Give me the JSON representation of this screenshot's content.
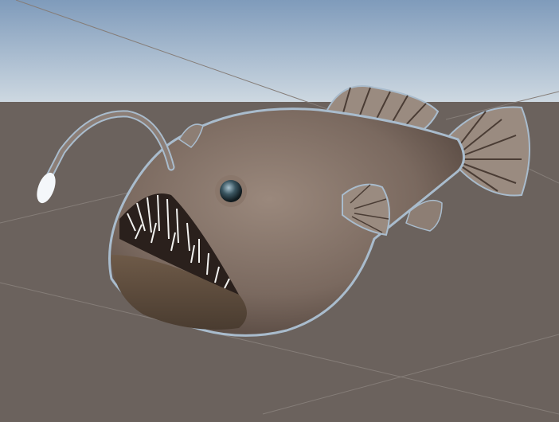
{
  "scene": {
    "view": "3d-scene-view",
    "subject": "anglerfish-model",
    "colors": {
      "sky_top": "#7f9bbb",
      "sky_horizon": "#c9d5df",
      "ground": "#6b625d",
      "grid_line": "#8a827d",
      "fish_body": "#7c6b62",
      "fish_dark": "#4e4039",
      "fin": "#9a8b80",
      "lure": "#f4f7fa",
      "outline": "#9fb4c9"
    }
  }
}
